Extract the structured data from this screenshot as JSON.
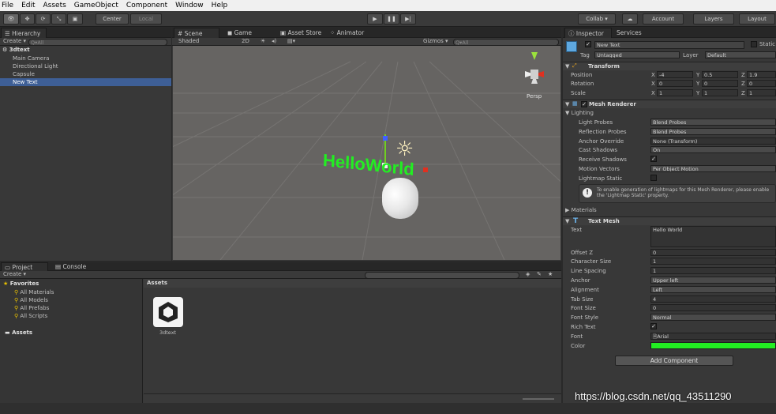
{
  "menu": [
    "File",
    "Edit",
    "Assets",
    "GameObject",
    "Component",
    "Window",
    "Help"
  ],
  "toolbar": {
    "center": "Center",
    "local": "Local",
    "collab": "Collab ▾",
    "account": "Account",
    "layers": "Layers",
    "layout": "Layout"
  },
  "hierarchy": {
    "tab": "Hierarchy",
    "create": "Create ▾",
    "search": "Q▾All",
    "scene": "3dtext",
    "items": [
      "Main Camera",
      "Directional Light",
      "Capsule",
      "New Text"
    ],
    "selected": 3
  },
  "scene": {
    "tabs": [
      "Scene",
      "Game",
      "Asset Store",
      "Animator"
    ],
    "shading": "Shaded",
    "mode2d": "2D",
    "gizmos": "Gizmos ▾",
    "search": "Q▾All",
    "persp": "Persp",
    "world_text": "HelloWorld"
  },
  "project": {
    "tabs": [
      "Project",
      "Console"
    ],
    "create": "Create ▾",
    "favorites_label": "Favorites",
    "favorites": [
      "All Materials",
      "All Models",
      "All Prefabs",
      "All Scripts"
    ],
    "assets_label": "Assets",
    "header": "Assets",
    "asset_name": "3dtext"
  },
  "inspector": {
    "tabs": [
      "Inspector",
      "Services"
    ],
    "object_name": "New Text",
    "static_label": "Static",
    "tag_label": "Tag",
    "tag": "Untagged",
    "layer_label": "Layer",
    "layer": "Default",
    "transform": {
      "title": "Transform",
      "rows": [
        {
          "label": "Position",
          "x": "-4",
          "y": "0.5",
          "z": "1.9"
        },
        {
          "label": "Rotation",
          "x": "0",
          "y": "0",
          "z": "0"
        },
        {
          "label": "Scale",
          "x": "1",
          "y": "1",
          "z": "1"
        }
      ]
    },
    "mesh_renderer": {
      "title": "Mesh Renderer",
      "lighting": "Lighting",
      "rows": [
        {
          "label": "Light Probes",
          "value": "Blend Probes"
        },
        {
          "label": "Reflection Probes",
          "value": "Blend Probes"
        },
        {
          "label": "Anchor Override",
          "value": "None (Transform)"
        },
        {
          "label": "Cast Shadows",
          "value": "On"
        },
        {
          "label": "Receive Shadows",
          "value": "✓"
        },
        {
          "label": "Motion Vectors",
          "value": "Per Object Motion"
        },
        {
          "label": "Lightmap Static",
          "value": ""
        }
      ],
      "info": "To enable generation of lightmaps for this Mesh Renderer, please enable the 'Lightmap Static' property.",
      "materials": "Materials"
    },
    "text_mesh": {
      "title": "Text Mesh",
      "text_label": "Text",
      "text": "Hello World",
      "rows": [
        {
          "label": "Offset Z",
          "value": "0"
        },
        {
          "label": "Character Size",
          "value": "1"
        },
        {
          "label": "Line Spacing",
          "value": "1"
        },
        {
          "label": "Anchor",
          "value": "Upper left"
        },
        {
          "label": "Alignment",
          "value": "Left"
        },
        {
          "label": "Tab Size",
          "value": "4"
        },
        {
          "label": "Font Size",
          "value": "0"
        },
        {
          "label": "Font Style",
          "value": "Normal"
        },
        {
          "label": "Rich Text",
          "value": "✓"
        },
        {
          "label": "Font",
          "value": "Arial"
        },
        {
          "label": "Color",
          "value": ""
        }
      ],
      "color": "#22ee22"
    },
    "add_component": "Add Component"
  },
  "watermark": "https://blog.csdn.net/qq_43511290"
}
